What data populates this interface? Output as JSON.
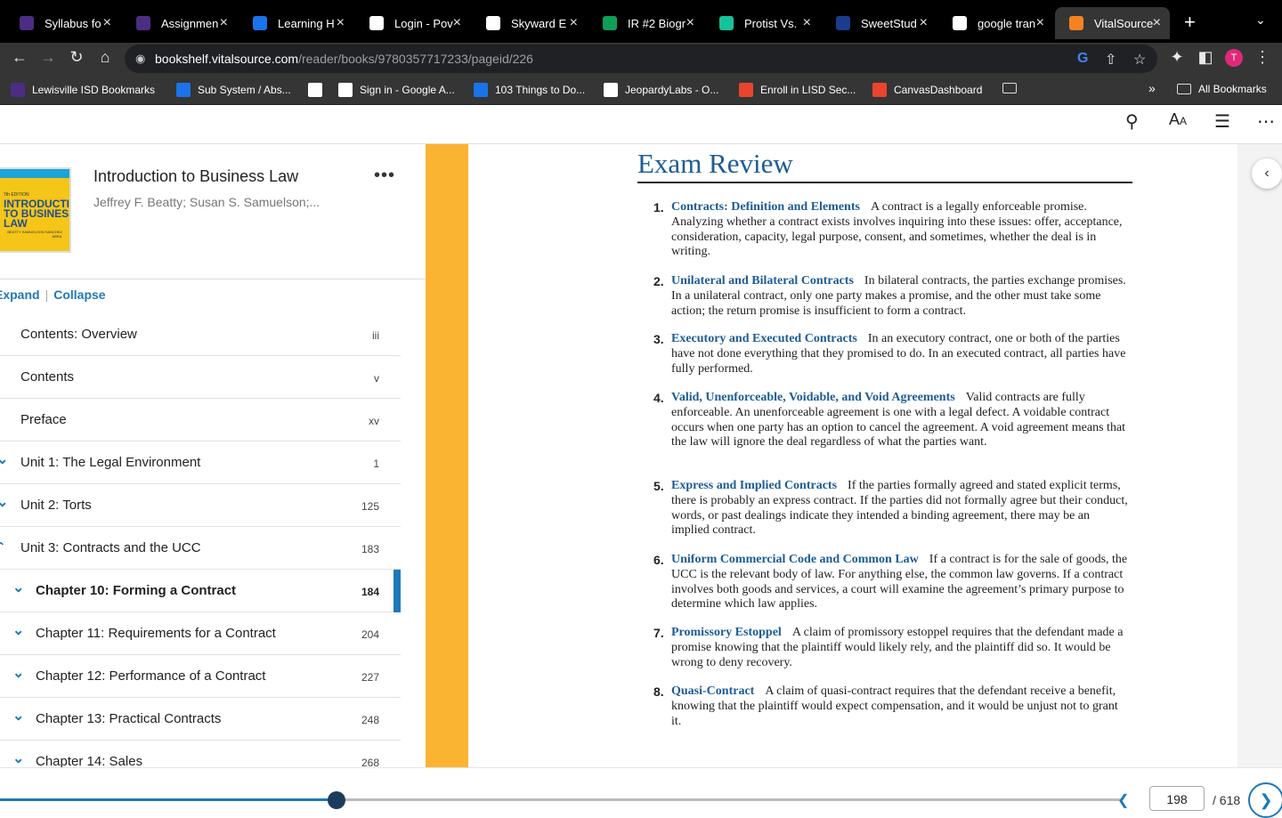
{
  "browser": {
    "tabs": [
      {
        "title": "Syllabus fo",
        "icon": "moodle-icon",
        "color": "#4b2e83"
      },
      {
        "title": "Assignmen",
        "icon": "moodle-icon",
        "color": "#4b2e83"
      },
      {
        "title": "Learning H",
        "icon": "cloud-icon",
        "color": "#1a73e8"
      },
      {
        "title": "Login - Pov",
        "icon": "skyward-icon",
        "color": "#ffffff"
      },
      {
        "title": "Skyward E",
        "icon": "skyward-icon",
        "color": "#ffffff"
      },
      {
        "title": "IR #2 Biogr",
        "icon": "sheets-icon",
        "color": "#0f9d58"
      },
      {
        "title": "Protist Vs.",
        "icon": "grammarly-icon",
        "color": "#15c39a"
      },
      {
        "title": "SweetStud",
        "icon": "sweetstudy-icon",
        "color": "#1a3c8c"
      },
      {
        "title": "google tran",
        "icon": "google-icon",
        "color": "#ffffff"
      },
      {
        "title": "VitalSource",
        "icon": "vitalsource-icon",
        "color": "#f58220"
      }
    ],
    "url_host": "bookshelf.vitalsource.com",
    "url_path": "/reader/books/9780357717233/pageid/226",
    "profile_initial": "T",
    "bookmarks": [
      "Lewisville ISD Bookmarks",
      "Sub System / Abs...",
      "",
      "Sign in - Google A...",
      "103 Things to Do...",
      "JeopardyLabs - O...",
      "Enroll in LISD Sec...",
      "CanvasDashboard"
    ],
    "all_bookmarks": "All Bookmarks",
    "overflow": "»"
  },
  "reader": {
    "book_title": "Introduction to Business Law",
    "book_authors": "Jeffrey F. Beatty; Susan S. Samuelson;...",
    "cover_text": "INTRODUCTION TO BUSINESS LAW",
    "cover_authors": "BEATTY SAMUELSON SANCHEZ ABRIL",
    "cover_edition": "7th EDITION",
    "expand_label": "Expand",
    "collapse_label": "Collapse",
    "toc": [
      {
        "label": "Contents: Overview",
        "page": "iii",
        "level": 0,
        "chevron": "",
        "selected": false
      },
      {
        "label": "Contents",
        "page": "v",
        "level": 0,
        "chevron": "",
        "selected": false
      },
      {
        "label": "Preface",
        "page": "xv",
        "level": 0,
        "chevron": "",
        "selected": false
      },
      {
        "label": "Unit 1: The Legal Environment",
        "page": "1",
        "level": 0,
        "chevron": "down",
        "selected": false
      },
      {
        "label": "Unit 2: Torts",
        "page": "125",
        "level": 0,
        "chevron": "down",
        "selected": false
      },
      {
        "label": "Unit 3: Contracts and the UCC",
        "page": "183",
        "level": 0,
        "chevron": "up",
        "selected": false
      },
      {
        "label": "Chapter 10: Forming a Contract",
        "page": "184",
        "level": 1,
        "chevron": "down",
        "selected": true
      },
      {
        "label": "Chapter 11: Requirements for a Contract",
        "page": "204",
        "level": 1,
        "chevron": "down",
        "selected": false
      },
      {
        "label": "Chapter 12: Performance of a Contract",
        "page": "227",
        "level": 1,
        "chevron": "down",
        "selected": false
      },
      {
        "label": "Chapter 13: Practical Contracts",
        "page": "248",
        "level": 1,
        "chevron": "down",
        "selected": false
      },
      {
        "label": "Chapter 14: Sales",
        "page": "268",
        "level": 1,
        "chevron": "down",
        "selected": false
      }
    ],
    "page_heading": "Exam Review",
    "exam_items": [
      {
        "num": "1.",
        "heading": "Contracts: Definition and Elements",
        "text": "A contract is a legally enforceable promise. Analyzing whether a contract exists involves inquiring into these issues: offer, acceptance, consideration, capacity, legal purpose, consent, and sometimes, whether the deal is in writing."
      },
      {
        "num": "2.",
        "heading": "Unilateral and Bilateral Contracts",
        "text": "In bilateral contracts, the parties exchange promises. In a unilateral contract, only one party makes a promise, and the other must take some action; the return promise is insufficient to form a contract."
      },
      {
        "num": "3.",
        "heading": "Executory and Executed Contracts",
        "text": "In an executory contract, one or both of the parties have not done everything that they promised to do. In an executed contract, all parties have fully performed."
      },
      {
        "num": "4.",
        "heading": "Valid, Unenforceable, Voidable, and Void Agreements",
        "text": "Valid contracts are fully enforceable. An unenforceable agreement is one with a legal defect. A voidable contract occurs when one party has an option to cancel the agreement. A void agreement means that the law will ignore the deal regardless of what the parties want."
      },
      {
        "num": "5.",
        "heading": "Express and Implied Contracts",
        "text": "If the parties formally agreed and stated explicit terms, there is probably an express contract. If the parties did not formally agree but their conduct, words, or past dealings indicate they intended a binding agreement, there may be an implied contract."
      },
      {
        "num": "6.",
        "heading": "Uniform Commercial Code and Common Law",
        "text": "If a contract is for the sale of goods, the UCC is the relevant body of law. For anything else, the common law governs. If a contract involves both goods and services, a court will examine the agreement’s primary purpose to determine which law applies."
      },
      {
        "num": "7.",
        "heading": "Promissory Estoppel",
        "text": "A claim of promissory estoppel requires that the defendant made a promise knowing that the plaintiff would likely rely, and the plaintiff did so. It would be wrong to deny recovery."
      },
      {
        "num": "8.",
        "heading": "Quasi-Contract",
        "text": "A claim of quasi-contract requires that the defendant receive a benefit, knowing that the plaintiff would expect compensation, and it would be unjust not to grant it."
      }
    ],
    "current_page": "198",
    "total_pages": "/ 618",
    "progress_fraction": 0.3,
    "accent_color": "#1d79b8",
    "strip_color": "#fbb431"
  }
}
